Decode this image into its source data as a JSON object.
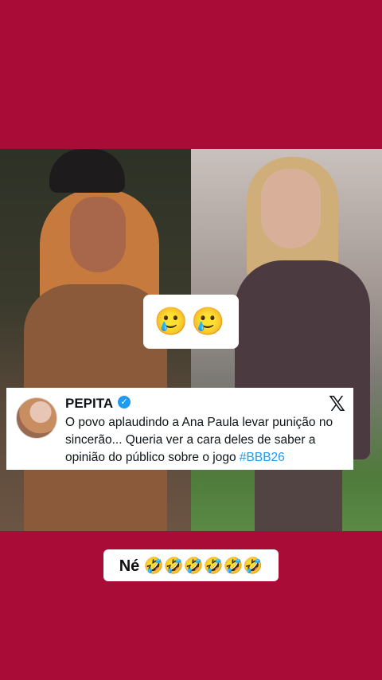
{
  "emoji_box": {
    "text": "🥲🥲"
  },
  "tweet": {
    "author": "PEPITA",
    "text_main": "O povo aplaudindo a Ana Paula levar punição no sincerão... Queria ver a cara deles de saber a opinião do público sobre o jogo ",
    "hashtag": "#BBB26",
    "verified_glyph": "✓",
    "x_logo": "𝕏"
  },
  "caption": {
    "text": "Né 🤣🤣🤣🤣🤣🤣"
  },
  "colors": {
    "background": "#a80c37",
    "hashtag": "#1d9bf0"
  }
}
